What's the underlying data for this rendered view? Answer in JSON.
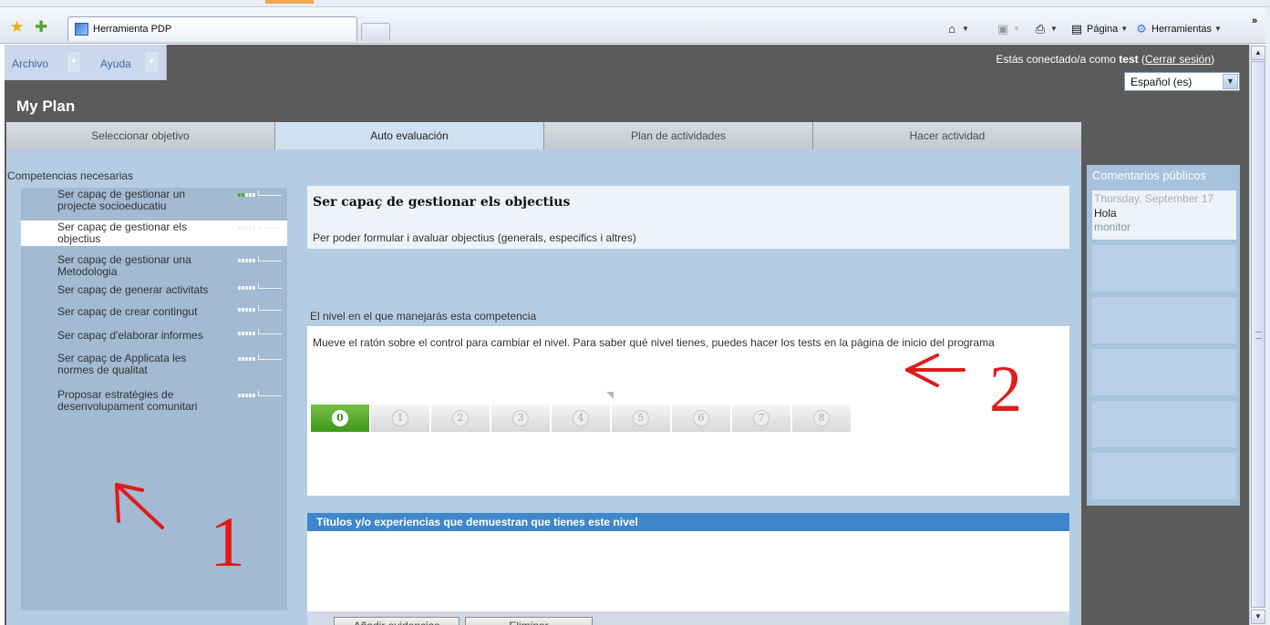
{
  "browser": {
    "tab_title": "Herramienta PDP",
    "command_bar": {
      "page_label": "Página",
      "tools_label": "Herramientas",
      "overflow": "»"
    }
  },
  "app": {
    "menu": [
      {
        "label": "Archivo"
      },
      {
        "label": "Ayuda"
      }
    ],
    "session": {
      "prefix": "Estás conectado/a como ",
      "user": "test",
      "logout": "Cerrar sesión"
    },
    "language": "Español (es)",
    "title": "My Plan",
    "steps": [
      {
        "label": "Seleccionar objetivo",
        "active": false
      },
      {
        "label": "Auto evaluación",
        "active": true
      },
      {
        "label": "Plan de actividades",
        "active": false
      },
      {
        "label": "Hacer actividad",
        "active": false
      }
    ],
    "competencies_heading": "Competencias necesarias",
    "competencies": [
      {
        "label": "Ser capaç de gestionar un projecte socioeducatiu",
        "level_fraction": 0.4,
        "selected": false
      },
      {
        "label": "Ser capaç de gestionar els objectius",
        "level_fraction": 0.0,
        "selected": true
      },
      {
        "label": "Ser capaç de gestionar una Metodologia",
        "level_fraction": 0.0,
        "selected": false
      },
      {
        "label": "Ser capaç de generar activitats",
        "level_fraction": 0.0,
        "selected": false
      },
      {
        "label": "Ser capaç de crear contingut",
        "level_fraction": 0.0,
        "selected": false
      },
      {
        "label": "Ser capaç d'elaborar informes",
        "level_fraction": 0.0,
        "selected": false
      },
      {
        "label": "Ser capaç de Applicata les normes de qualitat",
        "level_fraction": 0.0,
        "selected": false
      },
      {
        "label": "Proposar estratègies de desenvolupament comunitari",
        "level_fraction": 0.0,
        "selected": false
      }
    ],
    "competency": {
      "title": "Ser capaç de gestionar els objectius",
      "description": "Per poder formular i avaluar objectius (generals, especifics i altres)"
    },
    "level": {
      "label": "El nivel en el que manejarás esta competencia",
      "help": "Mueve el ratón sobre el control para cambiar el nivel. Para saber qué nivel tienes, puedes hacer los tests en la página de inicio del programa",
      "values": [
        "0",
        "1",
        "2",
        "3",
        "4",
        "5",
        "6",
        "7",
        "8"
      ],
      "current": 0
    },
    "evidence": {
      "header": "Títulos y/o experiencias que demuestran que tienes este nivel",
      "add_button": "Añadir evidencias",
      "delete_button": "Eliminar"
    },
    "public_comments": {
      "title": "Comentarios públicos",
      "items": [
        {
          "date": "Thursday, September 17",
          "text": "Hola",
          "author": "monitor"
        }
      ]
    }
  },
  "annotations": {
    "label_1": "1",
    "label_2": "2",
    "color": "#e01b1b"
  }
}
